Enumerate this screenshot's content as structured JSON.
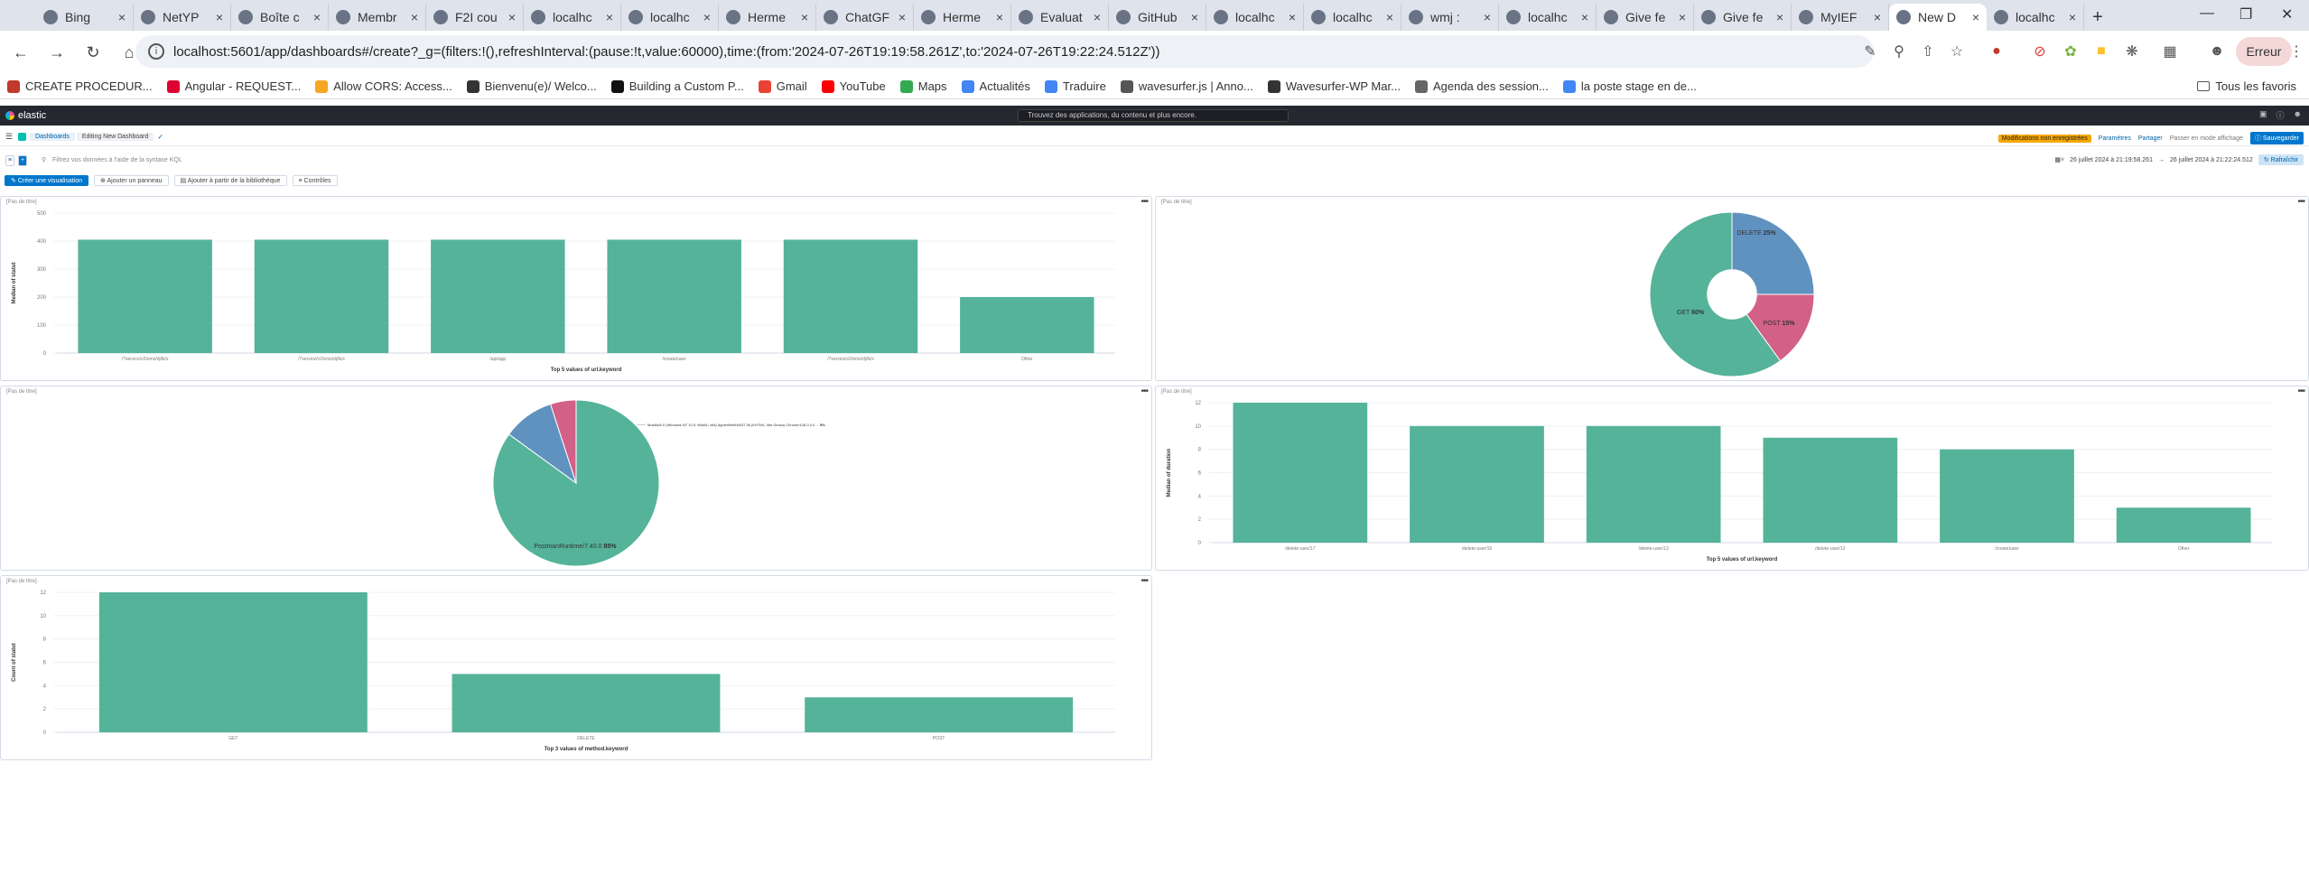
{
  "browser": {
    "tabs": [
      {
        "title": "Bing",
        "icon": "search-icon"
      },
      {
        "title": "NetYP",
        "icon": "netyp-icon"
      },
      {
        "title": "Boîte c",
        "icon": "gmail-icon"
      },
      {
        "title": "Membr",
        "icon": "gitlab-icon"
      },
      {
        "title": "F2I cou",
        "icon": "course-icon"
      },
      {
        "title": "localhc",
        "icon": "globe-icon"
      },
      {
        "title": "localhc",
        "icon": "globe-icon"
      },
      {
        "title": "Herme",
        "icon": "github-icon"
      },
      {
        "title": "ChatGF",
        "icon": "chatgpt-icon"
      },
      {
        "title": "Herme",
        "icon": "github-icon"
      },
      {
        "title": "Evaluat",
        "icon": "star-icon"
      },
      {
        "title": "GitHub",
        "icon": "github-icon"
      },
      {
        "title": "localhc",
        "icon": "elastic-icon"
      },
      {
        "title": "localhc",
        "icon": "globe-icon"
      },
      {
        "title": "wmj :",
        "icon": "terminal-icon"
      },
      {
        "title": "localhc",
        "icon": "elastic-icon"
      },
      {
        "title": "Give fe",
        "icon": "feedback-icon"
      },
      {
        "title": "Give fe",
        "icon": "feedback-icon"
      },
      {
        "title": "MyIEF",
        "icon": "page-icon"
      },
      {
        "title": "New D",
        "icon": "globe-icon",
        "active": true
      },
      {
        "title": "localhc",
        "icon": "globe-icon"
      }
    ],
    "url": "localhost:5601/app/dashboards#/create?_g=(filters:!(),refreshInterval:(pause:!t,value:60000),time:(from:'2024-07-26T19:19:58.261Z',to:'2024-07-26T19:22:24.512Z'))",
    "error_label": "Erreur",
    "bookmarks": [
      {
        "label": "CREATE PROCEDUR...",
        "color": "#c0392b"
      },
      {
        "label": "Angular - REQUEST...",
        "color": "#dd0031"
      },
      {
        "label": "Allow CORS: Access...",
        "color": "#f5a623"
      },
      {
        "label": "Bienvenu(e)/ Welco...",
        "color": "#333333"
      },
      {
        "label": "Building a Custom P...",
        "color": "#111111"
      },
      {
        "label": "Gmail",
        "color": "#ea4335"
      },
      {
        "label": "YouTube",
        "color": "#ff0000"
      },
      {
        "label": "Maps",
        "color": "#34a853"
      },
      {
        "label": "Actualités",
        "color": "#4285f4"
      },
      {
        "label": "Traduire",
        "color": "#4285f4"
      },
      {
        "label": "wavesurfer.js | Anno...",
        "color": "#555555"
      },
      {
        "label": "Wavesurfer-WP Mar...",
        "color": "#333333"
      },
      {
        "label": "Agenda des session...",
        "color": "#666666"
      },
      {
        "label": "la poste stage en de...",
        "color": "#4285f4"
      }
    ],
    "all_bookmarks_label": "Tous les favoris"
  },
  "kibana": {
    "brand": "elastic",
    "search_placeholder": "Trouvez des applications, du contenu et plus encore.",
    "breadcrumb_root": "Dashboards",
    "breadcrumb_current": "Editing New Dashboard",
    "unsaved_label": "Modifications non enregistrées",
    "settings_label": "Paramètres",
    "share_label": "Partager",
    "view_mode_label": "Passer en mode affichage",
    "save_label": "Sauvegarder",
    "query_placeholder": "Filtrez vos données à l'aide de la syntaxe KQL",
    "time_from": "26 juillet 2024 à 21:19:58.261",
    "time_to": "26 juillet 2024 à 21:22:24.512",
    "refresh_label": "Rafraîchir",
    "create_viz_label": "Créer une visualisation",
    "add_panel_label": "Ajouter un panneau",
    "add_library_label": "Ajouter à partir de la bibliothèque",
    "controls_label": "Contrôles",
    "no_title": "[Pas de titre]"
  },
  "colors": {
    "bar": "#54b399",
    "blue": "#6092c0",
    "pink": "#d36086"
  },
  "chart_data": [
    {
      "type": "bar",
      "categories": [
        "/?service/v2/ems/dj/lk/x",
        "/?service/v2/ems/dj/lk/x",
        "/api/app",
        "/create/user",
        "/?service/v2/ems/dj/lk/x",
        "Other"
      ],
      "values": [
        405,
        405,
        405,
        405,
        405,
        200
      ],
      "ylabel": "Median of statut",
      "xlabel": "Top 5 values of url.keyword",
      "yticks": [
        0,
        100,
        200,
        300,
        400,
        500
      ],
      "ylim": [
        0,
        500
      ]
    },
    {
      "type": "pie",
      "slices": [
        {
          "label": "DELETE",
          "pct": "25%",
          "value": 25,
          "color": "#6092c0"
        },
        {
          "label": "POST",
          "pct": "15%",
          "value": 15,
          "color": "#d36086"
        },
        {
          "label": "GET",
          "pct": "60%",
          "value": 60,
          "color": "#54b399"
        }
      ],
      "donut": true
    },
    {
      "type": "pie",
      "slices": [
        {
          "label": "PostmanRuntime/7.40.0",
          "pct": "85%",
          "value": 85,
          "color": "#54b399"
        },
        {
          "label": "",
          "pct": "",
          "value": 10,
          "color": "#6092c0"
        },
        {
          "label": "Mozilla/5.0 (Windows NT 10.0; Win64; x64) AppleWebKit/537.36 (KHTML, like Gecko) Chrome/126.0.0.0 ...",
          "pct": "5%",
          "value": 5,
          "color": "#d36086"
        }
      ],
      "donut": false
    },
    {
      "type": "bar",
      "categories": [
        "/delete-user/17",
        "/delete-user/15",
        "/delete-user/13",
        "/delete-user/12",
        "/create/user",
        "Other"
      ],
      "values": [
        12,
        10,
        10,
        9,
        8,
        3
      ],
      "ylabel": "Median of duration",
      "xlabel": "Top 5 values of url.keyword",
      "yticks": [
        0,
        2,
        4,
        6,
        8,
        10,
        12
      ],
      "ylim": [
        0,
        12
      ]
    },
    {
      "type": "bar",
      "categories": [
        "GET",
        "DELETE",
        "POST"
      ],
      "values": [
        12,
        5,
        3
      ],
      "ylabel": "Count of statut",
      "xlabel": "Top 3 values of method.keyword",
      "yticks": [
        0,
        2,
        4,
        6,
        8,
        10,
        12
      ],
      "ylim": [
        0,
        12
      ]
    }
  ]
}
